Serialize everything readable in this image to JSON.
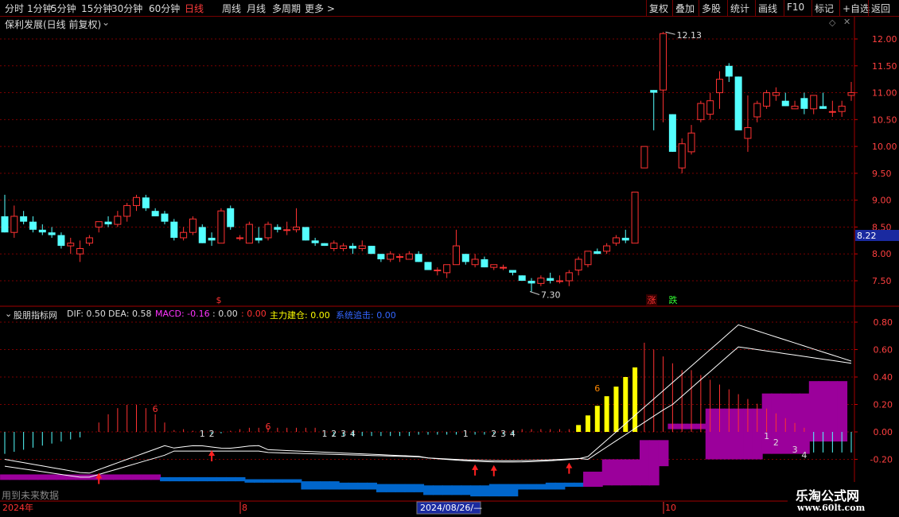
{
  "toolbar": {
    "left_items": [
      "分时",
      "1分钟",
      "5分钟",
      "15分钟",
      "30分钟",
      "60分钟",
      "日线",
      "周线",
      "月线",
      "多周期",
      "更多 >"
    ],
    "active": "日线",
    "right_items": [
      "复权",
      "叠加",
      "多股",
      "统计",
      "画线",
      "F10",
      "标记",
      "+自选",
      "返回"
    ]
  },
  "price_panel": {
    "title": "保利发展(日线 前复权)",
    "high_label": "12.13",
    "low_label": "7.30",
    "current_price": "8.22",
    "y_ticks": [
      "12.00",
      "11.50",
      "11.00",
      "10.50",
      "10.00",
      "9.50",
      "9.00",
      "8.50",
      "8.00",
      "7.50"
    ],
    "markers": {
      "s": "$",
      "up": "涨",
      "down": "跌"
    }
  },
  "indicator_panel": {
    "title": "股朋指标网",
    "dif": "DIF: 0.50",
    "dea": "DEA: 0.58",
    "macd": "MACD: -0.16",
    "v1": ": 0.00",
    "v2": ": 0.00",
    "main_label": "主力建仓: 0.00",
    "sys_label": "系统追击: 0.00",
    "y_ticks": [
      "0.80",
      "0.60",
      "0.40",
      "0.20",
      "0.00",
      "-0.20"
    ],
    "note": "用到未来数据",
    "six_marks": [
      "6",
      "6",
      "6"
    ]
  },
  "axis": {
    "year": "2024年",
    "m8": "8",
    "cursor_date": "2024/08/26/—",
    "m10": "10"
  },
  "watermark": {
    "name": "乐淘公式网",
    "url": "www.60lt.com"
  },
  "colors": {
    "up": "#ff3232",
    "down": "#54ffff",
    "grid": "#7a0000",
    "purple": "#9b009b",
    "blue": "#0066cc",
    "yellow": "#ffff00"
  },
  "chart_data": {
    "type": "candlestick",
    "ohlc": [
      [
        8.7,
        9.1,
        8.4,
        8.4
      ],
      [
        8.4,
        8.9,
        8.3,
        8.7
      ],
      [
        8.7,
        8.8,
        8.55,
        8.6
      ],
      [
        8.6,
        8.7,
        8.4,
        8.45
      ],
      [
        8.45,
        8.55,
        8.35,
        8.4
      ],
      [
        8.4,
        8.5,
        8.3,
        8.35
      ],
      [
        8.35,
        8.4,
        8.1,
        8.15
      ],
      [
        8.15,
        8.3,
        8.0,
        8.2
      ],
      [
        8.0,
        8.25,
        7.85,
        8.1
      ],
      [
        8.2,
        8.35,
        8.15,
        8.3
      ],
      [
        8.5,
        8.6,
        8.4,
        8.6
      ],
      [
        8.6,
        8.7,
        8.5,
        8.55
      ],
      [
        8.55,
        8.8,
        8.5,
        8.7
      ],
      [
        8.7,
        8.95,
        8.6,
        8.9
      ],
      [
        8.9,
        9.1,
        8.8,
        9.05
      ],
      [
        9.05,
        9.1,
        8.8,
        8.85
      ],
      [
        8.8,
        8.85,
        8.7,
        8.7
      ],
      [
        8.75,
        8.8,
        8.55,
        8.6
      ],
      [
        8.6,
        8.65,
        8.25,
        8.3
      ],
      [
        8.3,
        8.5,
        8.25,
        8.4
      ],
      [
        8.4,
        8.7,
        8.35,
        8.65
      ],
      [
        8.5,
        8.55,
        8.2,
        8.2
      ],
      [
        8.3,
        8.4,
        8.15,
        8.25
      ],
      [
        8.2,
        8.85,
        8.2,
        8.8
      ],
      [
        8.85,
        8.9,
        8.45,
        8.5
      ],
      [
        8.3,
        8.35,
        8.25,
        8.3
      ],
      [
        8.2,
        8.6,
        8.2,
        8.55
      ],
      [
        8.3,
        8.5,
        8.2,
        8.25
      ],
      [
        8.3,
        8.6,
        8.25,
        8.55
      ],
      [
        8.5,
        8.55,
        8.4,
        8.45
      ],
      [
        8.45,
        8.6,
        8.35,
        8.45
      ],
      [
        8.45,
        8.85,
        8.4,
        8.5
      ],
      [
        8.5,
        8.5,
        8.25,
        8.25
      ],
      [
        8.25,
        8.3,
        8.15,
        8.2
      ],
      [
        8.2,
        8.2,
        8.15,
        8.15
      ],
      [
        8.1,
        8.25,
        8.05,
        8.2
      ],
      [
        8.1,
        8.2,
        8.05,
        8.15
      ],
      [
        8.15,
        8.2,
        8.0,
        8.1
      ],
      [
        8.1,
        8.25,
        8.05,
        8.15
      ],
      [
        8.15,
        8.15,
        8.0,
        8.0
      ],
      [
        8.0,
        8.0,
        7.85,
        7.9
      ],
      [
        7.9,
        8.05,
        7.85,
        8.0
      ],
      [
        7.95,
        8.0,
        7.85,
        7.95
      ],
      [
        7.9,
        8.05,
        7.9,
        8.0
      ],
      [
        8.0,
        8.05,
        7.85,
        7.85
      ],
      [
        7.85,
        7.85,
        7.7,
        7.7
      ],
      [
        7.7,
        7.75,
        7.6,
        7.7
      ],
      [
        7.65,
        7.8,
        7.55,
        7.8
      ],
      [
        7.8,
        8.45,
        7.8,
        8.15
      ],
      [
        8.0,
        8.0,
        7.8,
        7.85
      ],
      [
        7.8,
        8.0,
        7.75,
        7.9
      ],
      [
        7.9,
        7.95,
        7.75,
        7.75
      ],
      [
        7.75,
        7.8,
        7.7,
        7.8
      ],
      [
        7.75,
        7.8,
        7.7,
        7.75
      ],
      [
        7.7,
        7.7,
        7.6,
        7.65
      ],
      [
        7.6,
        7.6,
        7.5,
        7.5
      ],
      [
        7.5,
        7.55,
        7.3,
        7.45
      ],
      [
        7.45,
        7.6,
        7.4,
        7.55
      ],
      [
        7.55,
        7.65,
        7.45,
        7.5
      ],
      [
        7.5,
        7.6,
        7.45,
        7.5
      ],
      [
        7.5,
        7.7,
        7.4,
        7.65
      ],
      [
        7.7,
        7.95,
        7.6,
        7.9
      ],
      [
        7.8,
        8.05,
        7.75,
        8.05
      ],
      [
        8.05,
        8.1,
        8.0,
        8.0
      ],
      [
        8.05,
        8.2,
        8.0,
        8.15
      ],
      [
        8.2,
        8.35,
        8.15,
        8.3
      ],
      [
        8.3,
        8.45,
        8.2,
        8.25
      ],
      [
        8.2,
        9.15,
        8.2,
        9.15
      ],
      [
        9.6,
        10.0,
        9.6,
        10.0
      ],
      [
        11.05,
        11.05,
        10.3,
        11.0
      ],
      [
        11.05,
        12.13,
        10.45,
        12.1
      ],
      [
        10.6,
        10.6,
        9.9,
        9.9
      ],
      [
        9.6,
        10.15,
        9.5,
        10.05
      ],
      [
        9.9,
        10.4,
        9.85,
        10.25
      ],
      [
        10.5,
        10.85,
        10.45,
        10.8
      ],
      [
        10.6,
        11.0,
        10.5,
        10.85
      ],
      [
        11.0,
        11.4,
        10.7,
        11.25
      ],
      [
        11.5,
        11.55,
        11.2,
        11.3
      ],
      [
        11.3,
        11.3,
        10.35,
        10.3
      ],
      [
        10.15,
        10.95,
        9.9,
        10.35
      ],
      [
        10.55,
        10.85,
        10.45,
        10.8
      ],
      [
        10.75,
        11.05,
        10.7,
        11.0
      ],
      [
        10.95,
        11.1,
        10.85,
        11.0
      ],
      [
        10.85,
        11.0,
        10.75,
        10.75
      ],
      [
        10.7,
        10.85,
        10.7,
        10.75
      ],
      [
        10.9,
        11.0,
        10.6,
        10.7
      ],
      [
        10.7,
        10.95,
        10.6,
        10.95
      ],
      [
        10.75,
        11.0,
        10.7,
        10.7
      ],
      [
        10.65,
        10.85,
        10.55,
        10.65
      ],
      [
        10.65,
        10.85,
        10.55,
        10.75
      ],
      [
        10.95,
        11.2,
        10.85,
        11.0
      ]
    ]
  }
}
